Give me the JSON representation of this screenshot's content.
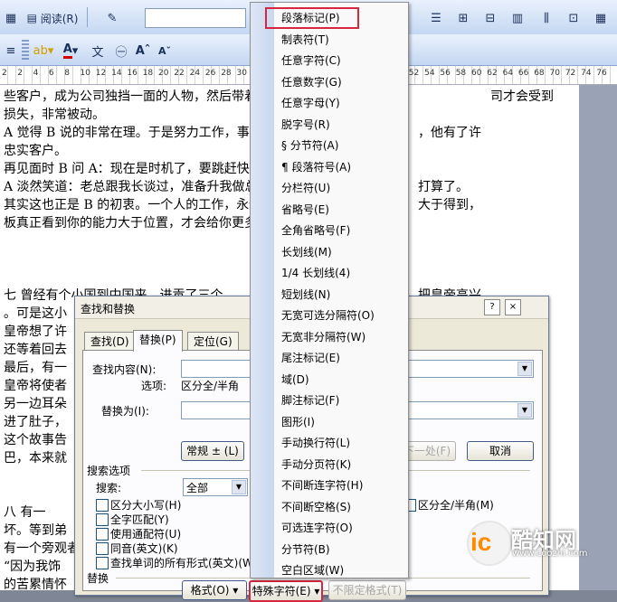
{
  "toolbar": {
    "read_button": "阅读(R)",
    "font_grow": "A",
    "font_shrink": "A"
  },
  "ruler": {
    "numbers": [
      "2",
      "2",
      "4",
      "6",
      "8",
      "10",
      "12",
      "14",
      "16",
      "18",
      "20",
      "22",
      "24",
      "26",
      "28",
      "30",
      "32",
      "34",
      "36",
      "38",
      "40",
      "42",
      "44",
      "46",
      "48",
      "50",
      "52",
      "54",
      "56",
      "58",
      "60",
      "62",
      "64",
      "66",
      "68",
      "70",
      "72",
      "74",
      "76"
    ]
  },
  "document": {
    "lines": [
      "些客户，成为公司独挡一面的人物，然后带着",
      "损失，非常被动。",
      "A 觉得 B 说的非常在理。于是努力工作，事",
      "忠实客户。",
      "再见面时 B 问 A：现在是时机了，要跳赶快行",
      "A 淡然笑道：老总跟我长谈过，准备升我做总",
      "其实这也正是 B 的初衷。一个人的工作，永远",
      "板真正看到你的能力大于位置，才会给你更多",
      "七      曾经有个小国到中国来，进贡了三个",
      "。可是这小",
      "皇帝想了许",
      "还等着回去",
      "最后，有一",
      "皇帝将使者",
      "另一边耳朵",
      "进了肚子，",
      "这个故事告",
      "巴，本来就",
      "八      有一",
      "坏。等到弟",
      "有一个旁观者",
      "“因为我饰",
      "的苦累情怀"
    ],
    "right_fragments": [
      "司才会受到",
      "，他有了许",
      "打算了。",
      "大于得到，",
      "把皇帝高兴"
    ]
  },
  "dialog": {
    "title": "查找和替换",
    "help": "?",
    "close": "×",
    "tabs": [
      "查找(D)",
      "替换(P)",
      "定位(G)"
    ],
    "find_label": "查找内容(N):",
    "options_label": "选项:",
    "options_value": "区分全/半角",
    "replace_label": "替换为(I):",
    "normal_button": "常规 ± (L)",
    "find_next": "下一处(F)",
    "cancel": "取消",
    "search_options": "搜索选项",
    "search_label": "搜索:",
    "search_value": "全部",
    "checkboxes": [
      "区分大小写(H)",
      "全字匹配(Y)",
      "使用通配符(U)",
      "同音(英文)(K)",
      "查找单词的所有形式(英文)(W)"
    ],
    "right_checkbox": "区分全/半角(M)",
    "replace_section": "替换",
    "format_button": "格式(O) ▾",
    "special_button": "特殊字符(E) ▾",
    "no_format_button": "不限定格式(T)"
  },
  "menu": {
    "items": [
      "段落标记(P)",
      "制表符(T)",
      "任意字符(C)",
      "任意数字(G)",
      "任意字母(Y)",
      "脱字号(R)",
      "§ 分节符(A)",
      "¶ 段落符号(A)",
      "分栏符(U)",
      "省略号(E)",
      "全角省略号(F)",
      "长划线(M)",
      "1/4 长划线(4)",
      "短划线(N)",
      "无宽可选分隔符(O)",
      "无宽非分隔符(W)",
      "尾注标记(E)",
      "域(D)",
      "脚注标记(F)",
      "图形(I)",
      "手动换行符(L)",
      "手动分页符(K)",
      "不间断连字符(H)",
      "不间断空格(S)",
      "可选连字符(O)",
      "分节符(B)",
      "空白区域(W)"
    ]
  },
  "watermark": {
    "name": "酷知网",
    "url": "www.coozhi.com",
    "logo": "ic"
  },
  "colors": {
    "highlight": "#d7263d",
    "dialog_bg": "#ece9d8",
    "toolbar_bg": "#c5d7f2"
  }
}
